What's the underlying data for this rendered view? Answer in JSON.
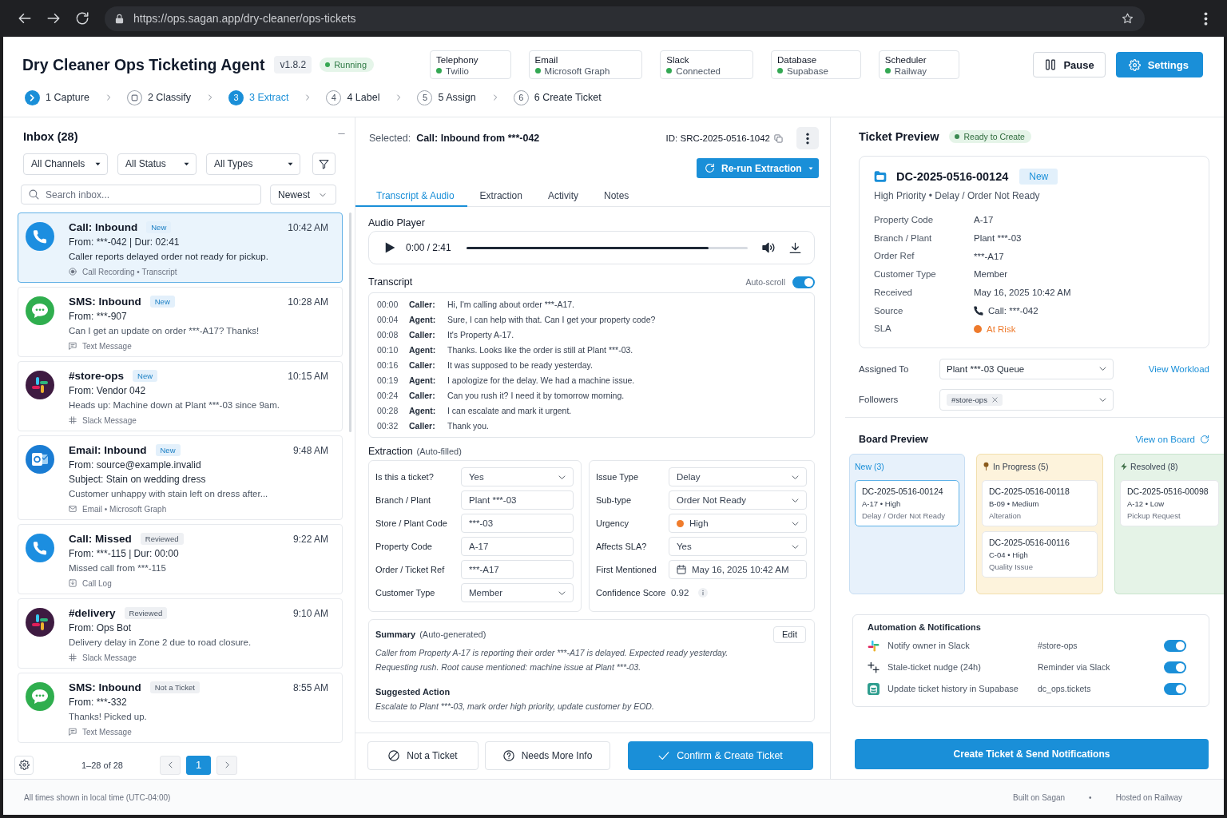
{
  "browser": {
    "url": "https://ops.sagan.app/dry-cleaner/ops-tickets"
  },
  "header": {
    "title": "Dry Cleaner Ops Ticketing Agent",
    "version": "v1.8.2",
    "status": "Running",
    "integrations": [
      {
        "name": "Telephony",
        "value": "Twilio",
        "connected": true
      },
      {
        "name": "Email",
        "value": "Microsoft Graph",
        "connected": true
      },
      {
        "name": "Slack",
        "value": "Connected",
        "connected": true
      },
      {
        "name": "Database",
        "value": "Supabase",
        "connected": true
      },
      {
        "name": "Scheduler",
        "value": "Railway",
        "connected": true
      }
    ],
    "buttons": [
      {
        "label": "Pause",
        "kind": "pause"
      },
      {
        "label": "Settings",
        "kind": "settings"
      }
    ]
  },
  "steps": [
    {
      "label": "1 Capture",
      "kind": "done"
    },
    {
      "label": "2 Classify",
      "kind": "idle"
    },
    {
      "number": "3",
      "label": "3 Extract",
      "kind": "current"
    },
    {
      "number": "4",
      "label": "4 Label",
      "kind": "pending"
    },
    {
      "number": "5",
      "label": "5 Assign",
      "kind": "pending"
    },
    {
      "number": "6",
      "label": "6 Create Ticket",
      "kind": "pending"
    }
  ],
  "inbox": {
    "title": "Inbox (28)",
    "filters": [
      "All Channels",
      "All Status",
      "All Types"
    ],
    "search": {
      "placeholder": "Search inbox..."
    },
    "sort": "Newest",
    "items": [
      {
        "kind": "call",
        "title": "Call: Inbound",
        "badge": {
          "text": "New",
          "kind": "new"
        },
        "time": "10:42 AM",
        "from": "From: ***-042 | Dur: 02:41",
        "snippet": "Caller reports delayed order not ready for pickup.",
        "meta": {
          "kind": "recording",
          "text": "Call Recording • Transcript"
        },
        "selected": true
      },
      {
        "kind": "sms",
        "title": "SMS: Inbound",
        "badge": {
          "text": "New",
          "kind": "new"
        },
        "time": "10:28 AM",
        "from": "From: ***-907",
        "snippet": "Can I get an update on order ***-A17? Thanks!",
        "meta": {
          "kind": "message",
          "text": "Text Message"
        },
        "selected": false
      },
      {
        "kind": "slack",
        "title": "#store-ops",
        "badge": {
          "text": "New",
          "kind": "new"
        },
        "time": "10:15 AM",
        "from": "From: Vendor 042",
        "snippet": "Heads up: Machine down at Plant ***-03 since 9am.",
        "meta": {
          "kind": "hash",
          "text": "Slack Message"
        },
        "selected": false
      },
      {
        "kind": "email",
        "title": "Email: Inbound",
        "badge": {
          "text": "New",
          "kind": "new"
        },
        "time": "9:48 AM",
        "from": "From: source@example.invalid",
        "subject": "Subject: Stain on wedding dress",
        "snippet": "Customer unhappy with stain left on dress after...",
        "meta": {
          "kind": "mail",
          "text": "Email • Microsoft Graph"
        },
        "selected": false
      },
      {
        "kind": "call",
        "title": "Call: Missed",
        "badge": {
          "text": "Reviewed",
          "kind": "muted"
        },
        "time": "9:22 AM",
        "from": "From: ***-115 | Dur: 00:00",
        "snippet": "Missed call from ***-115",
        "meta": {
          "kind": "log",
          "text": "Call Log"
        },
        "selected": false
      },
      {
        "kind": "slack",
        "title": "#delivery",
        "badge": {
          "text": "Reviewed",
          "kind": "muted"
        },
        "time": "9:10 AM",
        "from": "From: Ops Bot",
        "snippet": "Delivery delay in Zone 2 due to road closure.",
        "meta": {
          "kind": "hash",
          "text": "Slack Message"
        },
        "selected": false
      },
      {
        "kind": "sms",
        "title": "SMS: Inbound",
        "badge": {
          "text": "Not a Ticket",
          "kind": "muted"
        },
        "time": "8:55 AM",
        "from": "From: ***-332",
        "snippet": "Thanks! Picked up.",
        "meta": {
          "kind": "message",
          "text": "Text Message"
        },
        "selected": false
      }
    ],
    "pagination": {
      "range": "1–28 of 28",
      "pages": [
        {
          "label": "1",
          "selected": true
        }
      ]
    }
  },
  "detail": {
    "selected_label": "Selected:",
    "selected_value": "Call: Inbound from ***-042",
    "id": "ID: SRC-2025-0516-1042",
    "rerun": "Re-run Extraction",
    "tabs": [
      {
        "label": "Transcript & Audio",
        "selected": true
      },
      {
        "label": "Extraction",
        "selected": false
      },
      {
        "label": "Activity",
        "selected": false
      },
      {
        "label": "Notes",
        "selected": false
      }
    ],
    "audio": {
      "title": "Audio Player",
      "time": "0:00 / 2:41",
      "level": 0.86
    },
    "transcript": {
      "title": "Transcript",
      "auto_scroll_label": "Auto-scroll",
      "auto_scroll": true,
      "lines": [
        {
          "time": "00:00",
          "speaker": "Caller:",
          "text": "Hi, I'm calling about order ***-A17."
        },
        {
          "time": "00:04",
          "speaker": "Agent:",
          "text": "Sure, I can help with that. Can I get your property code?"
        },
        {
          "time": "00:08",
          "speaker": "Caller:",
          "text": "It's Property A-17."
        },
        {
          "time": "00:10",
          "speaker": "Agent:",
          "text": "Thanks. Looks like the order is still at Plant ***-03."
        },
        {
          "time": "00:16",
          "speaker": "Caller:",
          "text": "It was supposed to be ready yesterday."
        },
        {
          "time": "00:19",
          "speaker": "Agent:",
          "text": "I apologize for the delay. We had a machine issue."
        },
        {
          "time": "00:24",
          "speaker": "Caller:",
          "text": "Can you rush it? I need it by tomorrow morning."
        },
        {
          "time": "00:28",
          "speaker": "Agent:",
          "text": "I can escalate and mark it urgent."
        },
        {
          "time": "00:32",
          "speaker": "Caller:",
          "text": "Thank you."
        }
      ]
    },
    "extraction": {
      "title": "Extraction",
      "note": "(Auto-filled)",
      "groups": [
        [
          {
            "label": "Is this a ticket?",
            "kind": "select",
            "value": "Yes"
          },
          {
            "label": "Branch / Plant",
            "kind": "text",
            "value": "Plant ***-03"
          },
          {
            "label": "Store / Plant Code",
            "kind": "text",
            "value": "***-03"
          },
          {
            "label": "Property Code",
            "kind": "text",
            "value": "A-17"
          },
          {
            "label": "Order / Ticket Ref",
            "kind": "text",
            "value": "***-A17"
          },
          {
            "label": "Customer Type",
            "kind": "select",
            "value": "Member"
          }
        ],
        [
          {
            "label": "Issue Type",
            "kind": "select",
            "value": "Delay"
          },
          {
            "label": "Sub-type",
            "kind": "select",
            "value": "Order Not Ready"
          },
          {
            "label": "Urgency",
            "kind": "select",
            "value": "High",
            "color": "#f07c2c"
          },
          {
            "label": "Affects SLA?",
            "kind": "select",
            "value": "Yes"
          },
          {
            "label": "First Mentioned",
            "kind": "date",
            "value": "May 16, 2025 10:42 AM"
          },
          {
            "label": "Confidence Score",
            "kind": "score",
            "value": "0.92"
          }
        ]
      ]
    },
    "summary": {
      "title": "Summary",
      "note": "(Auto-generated)",
      "edit": "Edit",
      "text": "Caller from Property A-17 is reporting their order ***-A17 is delayed. Expected ready yesterday.\nRequesting rush. Root cause mentioned: machine issue at Plant ***-03.",
      "action_title": "Suggested Action",
      "action": "Escalate to Plant ***-03, mark order high priority, update customer by EOD."
    },
    "actions": [
      {
        "label": "Not a Ticket",
        "kind": "reject"
      },
      {
        "label": "Needs More Info",
        "kind": "question"
      },
      {
        "label": "Confirm & Create Ticket",
        "kind": "confirm"
      }
    ]
  },
  "ticket": {
    "title": "Ticket Preview",
    "status": "Ready to Create",
    "id": "DC-2025-0516-00124",
    "badge": "New",
    "tags": "High Priority • Delay / Order Not Ready",
    "fields": [
      {
        "label": "Property Code",
        "value": "A-17"
      },
      {
        "label": "Branch / Plant",
        "value": "Plant ***-03"
      },
      {
        "label": "Order Ref",
        "value": "***-A17"
      },
      {
        "label": "Customer Type",
        "value": "Member"
      },
      {
        "label": "Received",
        "value": "May 16, 2025 10:42 AM"
      },
      {
        "label": "Source",
        "value": "Call: ***-042",
        "kind": "call"
      },
      {
        "label": "SLA",
        "value": "At Risk",
        "kind": "dot",
        "color": "#ee7a2c"
      }
    ],
    "assigned": {
      "label": "Assigned To",
      "value": "Plant ***-03 Queue",
      "link": "View Workload"
    },
    "followers": {
      "label": "Followers",
      "chips": [
        "#store-ops"
      ]
    }
  },
  "board": {
    "title": "Board Preview",
    "link": "View on Board",
    "columns": [
      {
        "title": "New (3)",
        "kind": "new",
        "cards": [
          {
            "id": "DC-2025-0516-00124",
            "meta": "A-17 • High",
            "type": "Delay / Order Not Ready",
            "selected": true
          }
        ]
      },
      {
        "title": "In Progress (5)",
        "kind": "progress",
        "cards": [
          {
            "id": "DC-2025-0516-00118",
            "meta": "B-09 • Medium",
            "type": "Alteration",
            "selected": false
          },
          {
            "id": "DC-2025-0516-00116",
            "meta": "C-04 • High",
            "type": "Quality Issue",
            "selected": false
          }
        ]
      },
      {
        "title": "Resolved (8)",
        "kind": "resolved",
        "cards": [
          {
            "id": "DC-2025-0516-00098",
            "meta": "A-12 • Low",
            "type": "Pickup Request",
            "selected": false
          }
        ]
      }
    ]
  },
  "automation": {
    "title": "Automation & Notifications",
    "rows": [
      {
        "kind": "slack",
        "label": "Notify owner in Slack",
        "target": "#store-ops",
        "on": true
      },
      {
        "kind": "nudge",
        "label": "Stale-ticket nudge (24h)",
        "target": "Reminder via Slack",
        "on": true
      },
      {
        "kind": "database",
        "label": "Update ticket history in Supabase",
        "target": "dc_ops.tickets",
        "on": true
      }
    ]
  },
  "create_button": "Create Ticket & Send Notifications",
  "footer": {
    "note": "All times shown in local time (UTC-04:00)",
    "links": [
      "Built on Sagan",
      "•",
      "Hosted on Railway"
    ]
  }
}
